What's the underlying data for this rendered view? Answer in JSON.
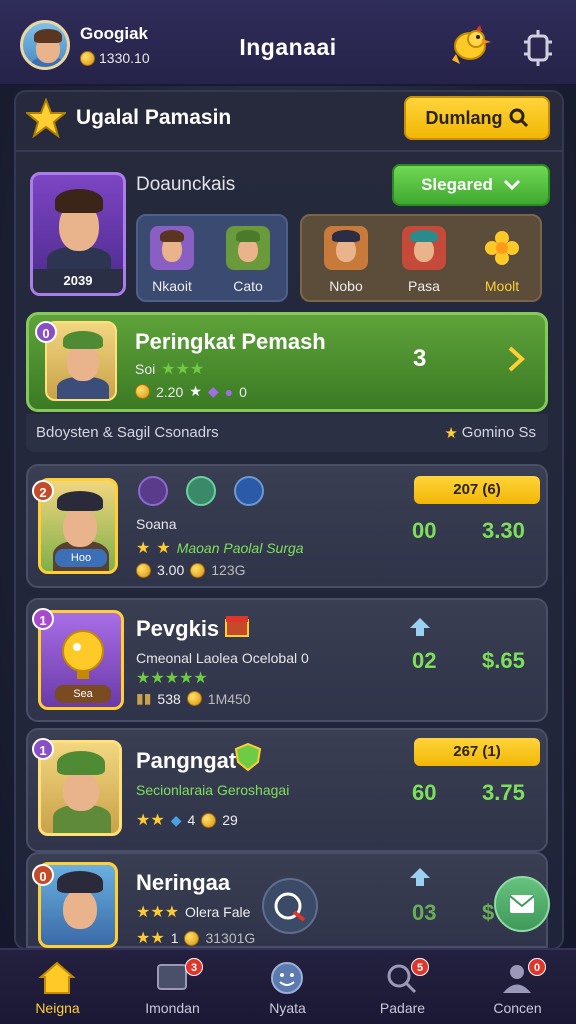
{
  "top_bar": {
    "username": "Googiak",
    "coins": "1330.10",
    "title": "Inganaai"
  },
  "header": {
    "title": "Ugalal Pamasin",
    "button_label": "Dumlang"
  },
  "profile": {
    "level": "2039",
    "section_label": "Doaunckais",
    "green_button": "Slegared",
    "team_a": [
      "Nkaoit",
      "Cato"
    ],
    "team_b": [
      "Nobo",
      "Pasa",
      "Moolt"
    ]
  },
  "rank_card": {
    "badge": "0",
    "title": "Peringkat Pemash",
    "sub": "Soi",
    "stat": "2.20",
    "stat2": "0",
    "value": "3"
  },
  "subheader": {
    "left": "Bdoysten & Sagil Csonadrs",
    "right": "Gomino Ss"
  },
  "items": [
    {
      "badge": "2",
      "title": "Soana",
      "sub": "Maoan Paolal Surga",
      "pill": "207 (6)",
      "left_score": "00",
      "price": "3.30",
      "stat_a": "3.00",
      "stat_b": "123G",
      "portrait_label": "Hoo"
    },
    {
      "badge": "1",
      "title": "Pevgkis",
      "sub": "Cmeonal Laolea Ocelobal 0",
      "left_score": "02",
      "price": "$.65",
      "stat_a": "538",
      "stat_b": "1M450",
      "portrait_label": "Sea"
    },
    {
      "badge": "1",
      "title": "Pangngat",
      "sub": "Secionlaraia Geroshagai",
      "pill": "267 (1)",
      "left_score": "60",
      "price": "3.75",
      "stat_a": "4",
      "stat_b": "29"
    },
    {
      "badge": "0",
      "title": "Neringaa",
      "sub": "Olera Fale",
      "left_score": "03",
      "price": "$",
      "stat_a": "1",
      "stat_b": "31301G"
    }
  ],
  "nav": [
    {
      "label": "Neigna",
      "icon": "home-icon",
      "active": true
    },
    {
      "label": "Imondan",
      "icon": "monitor-icon",
      "badge": "3"
    },
    {
      "label": "Nyata",
      "icon": "smile-icon"
    },
    {
      "label": "Padare",
      "icon": "search-icon",
      "badge": "5"
    },
    {
      "label": "Concen",
      "icon": "user-icon",
      "badge": "0"
    }
  ],
  "colors": {
    "accent_yellow": "#f2b705",
    "accent_green": "#3fa930",
    "score_green": "#7ee05a",
    "top_bar": "#2f2c5a",
    "panel": "#262a3c"
  }
}
